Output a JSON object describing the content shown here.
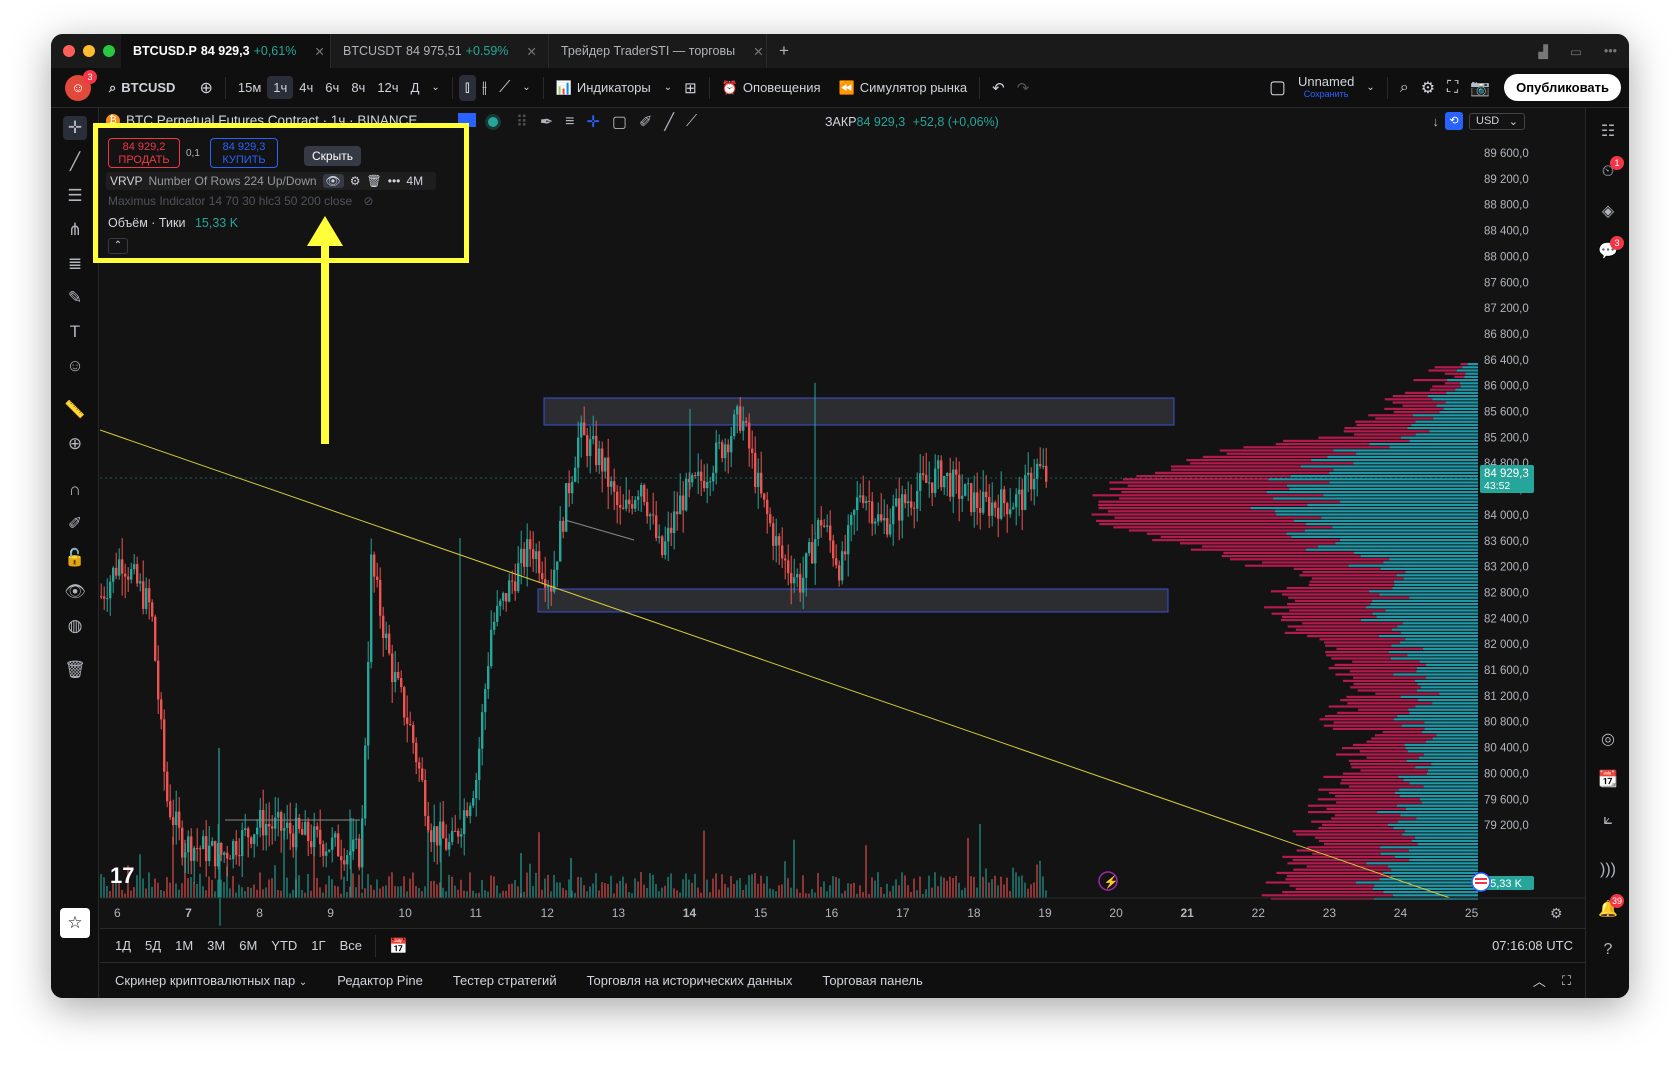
{
  "tabs": [
    {
      "label": "BTCUSD.P",
      "price": "84 929,3",
      "change": "+0,61%",
      "active": true
    },
    {
      "label": "BTCUSDT",
      "price": "84 975,51",
      "change": "+0.59%",
      "active": false
    },
    {
      "label": "Трейдер TraderSTI — торговы",
      "price": "",
      "change": "",
      "active": false
    }
  ],
  "toolbar": {
    "symbol": "BTCUSD",
    "intervals": [
      "15м",
      "1ч",
      "4ч",
      "6ч",
      "8ч",
      "12ч",
      "Д"
    ],
    "selected_interval": "1ч",
    "indicators": "Индикаторы",
    "alerts": "Оповещения",
    "replay": "Симулятор рынка",
    "layout_name": "Unnamed",
    "layout_sub": "Сохранить",
    "publish": "Опубликовать"
  },
  "legend": {
    "title": "BTC Perpetual Futures Contract · 1ч · BINANCE",
    "close_label": "ЗАКР",
    "close_value": "84 929,3",
    "close_change": "+52,8 (+0,06%)",
    "sell_price": "84 929,2",
    "sell_label": "ПРОДАТЬ",
    "spread": "0,1",
    "buy_price": "84 929,3",
    "buy_label": "КУПИТЬ",
    "tooltip": "Скрыть",
    "vrvp": "VRVP",
    "vrvp_params": "Number Of Rows 224 Up/Down",
    "vrvp_suffix": "4M",
    "maximus": "Maximus Indicator 14 70 30 hlc3 50 200 close",
    "volume_label": "Объём · Тики",
    "volume_value": "15,33 K"
  },
  "price_axis": {
    "currency": "USD",
    "labels": [
      "89 600,0",
      "89 200,0",
      "88 800,0",
      "88 400,0",
      "88 000,0",
      "87 600,0",
      "87 200,0",
      "86 800,0",
      "86 400,0",
      "86 000,0",
      "85 600,0",
      "85 200,0",
      "84 800,0",
      "84 400,0",
      "84 000,0",
      "83 600,0",
      "83 200,0",
      "82 800,0",
      "82 400,0",
      "82 000,0",
      "81 600,0",
      "81 200,0",
      "80 800,0",
      "80 400,0",
      "80 000,0",
      "79 600,0",
      "79 200,0"
    ],
    "last_price": "84 929,3",
    "countdown": "43:52",
    "volume_tag": "15,33 K"
  },
  "time_axis": {
    "labels": [
      "6",
      "7",
      "8",
      "9",
      "10",
      "11",
      "12",
      "13",
      "14",
      "15",
      "16",
      "17",
      "18",
      "19",
      "20",
      "21",
      "22",
      "23",
      "24",
      "25"
    ],
    "bold": [
      "7",
      "14",
      "21"
    ]
  },
  "ranges": [
    "1Д",
    "5Д",
    "1М",
    "3М",
    "6М",
    "YTD",
    "1Г",
    "Все"
  ],
  "clock": "07:16:08 UTC",
  "bottom_tabs": [
    "Скринер криптовалютных пар",
    "Редактор Pine",
    "Тестер стратегий",
    "Торговля на исторических данных",
    "Торговая панель"
  ],
  "right_badges": {
    "alerts": "1",
    "chat": "3",
    "notifications": "39"
  },
  "colors": {
    "up": "#26a69a",
    "down": "#ef5350",
    "highlight": "#ffff3a",
    "trendline": "#d6cc3a",
    "zone_border": "#3b4fd8"
  }
}
